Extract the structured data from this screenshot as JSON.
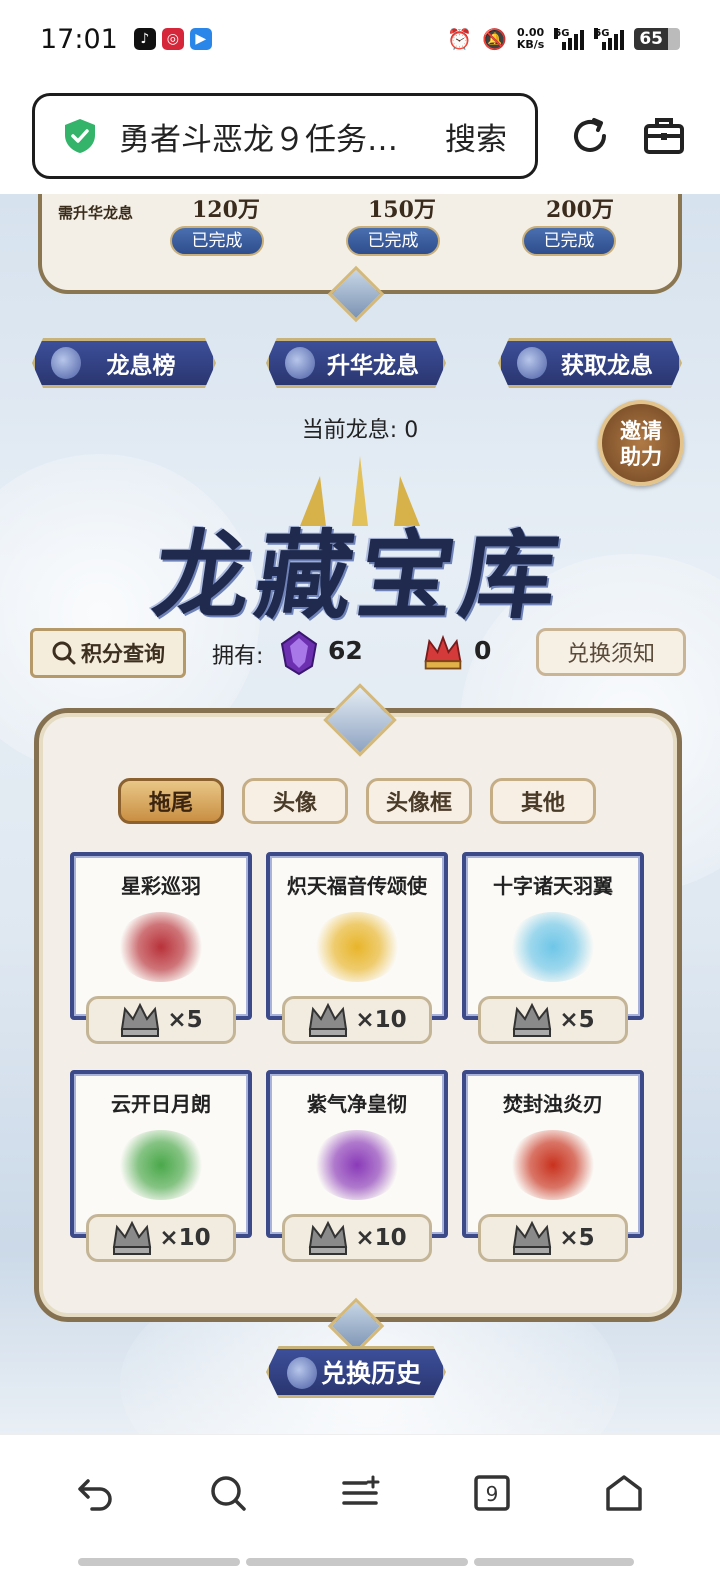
{
  "status_bar": {
    "time": "17:01",
    "net_speed_value": "0.00",
    "net_speed_unit": "KB/s",
    "sig1_label": "5G",
    "sig2_label": "5G",
    "battery": "65"
  },
  "browser": {
    "url_text": "勇者斗恶龙９任务…",
    "search_label": "搜索"
  },
  "top_panel": {
    "label": "需升华龙息",
    "values": [
      "120万",
      "150万",
      "200万"
    ],
    "status": [
      "已完成",
      "已完成",
      "已完成"
    ]
  },
  "nav_buttons": [
    "龙息榜",
    "升华龙息",
    "获取龙息"
  ],
  "current_breath": "当前龙息: 0",
  "invite_line1": "邀请",
  "invite_line2": "助力",
  "title_art": "龙藏宝库",
  "points_query": "积分查询",
  "owned_label": "拥有:",
  "owned_gem": "62",
  "owned_crown": "0",
  "exchange_rules": "兑换须知",
  "tabs": [
    "拖尾",
    "头像",
    "头像框",
    "其他"
  ],
  "active_tab": "拖尾",
  "items": [
    {
      "name": "星彩巡羽",
      "cost": "×5",
      "art_color": "#b8323a"
    },
    {
      "name": "炽天福音传颂使",
      "cost": "×10",
      "art_color": "#e8b52a"
    },
    {
      "name": "十字诸天羽翼",
      "cost": "×5",
      "art_color": "#6ec6e8"
    },
    {
      "name": "云开日月朗",
      "cost": "×10",
      "art_color": "#4aa84a"
    },
    {
      "name": "紫气净皇彻",
      "cost": "×10",
      "art_color": "#8a3ab8"
    },
    {
      "name": "焚封浊炎刃",
      "cost": "×5",
      "art_color": "#c8321e"
    }
  ],
  "exchange_history": "兑换历史",
  "colors": {
    "accent_blue": "#2e3c7e",
    "gold": "#c8b47a",
    "panel_bg": "#f3efe8"
  }
}
